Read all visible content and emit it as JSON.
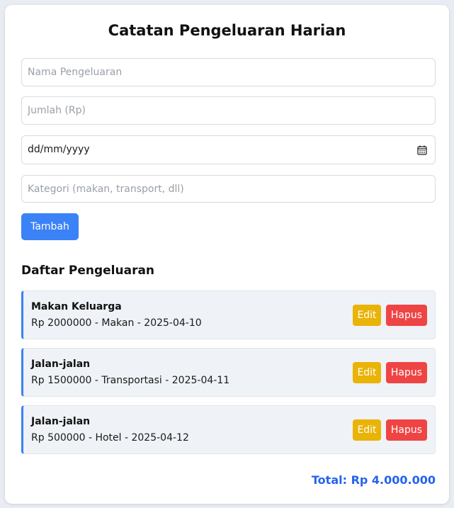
{
  "app": {
    "title": "Catatan Pengeluaran Harian"
  },
  "form": {
    "name_placeholder": "Nama Pengeluaran",
    "amount_placeholder": "Jumlah (Rp)",
    "date_value": "dd/mm/yyyy",
    "category_placeholder": "Kategori (makan, transport, dll)",
    "add_label": "Tambah"
  },
  "list": {
    "heading": "Daftar Pengeluaran",
    "edit_label": "Edit",
    "delete_label": "Hapus",
    "items": [
      {
        "name": "Makan Keluarga",
        "detail": "Rp 2000000 - Makan - 2025-04-10"
      },
      {
        "name": "Jalan-jalan",
        "detail": "Rp 1500000 - Transportasi - 2025-04-11"
      },
      {
        "name": "Jalan-jalan",
        "detail": "Rp 500000 - Hotel - 2025-04-12"
      }
    ]
  },
  "summary": {
    "total": "Total: Rp 4.000.000"
  },
  "colors": {
    "accent": "#3b82f6",
    "edit": "#eab308",
    "delete": "#ef4444",
    "total": "#2563eb"
  },
  "icons": {
    "date_picker": "calendar-icon"
  }
}
